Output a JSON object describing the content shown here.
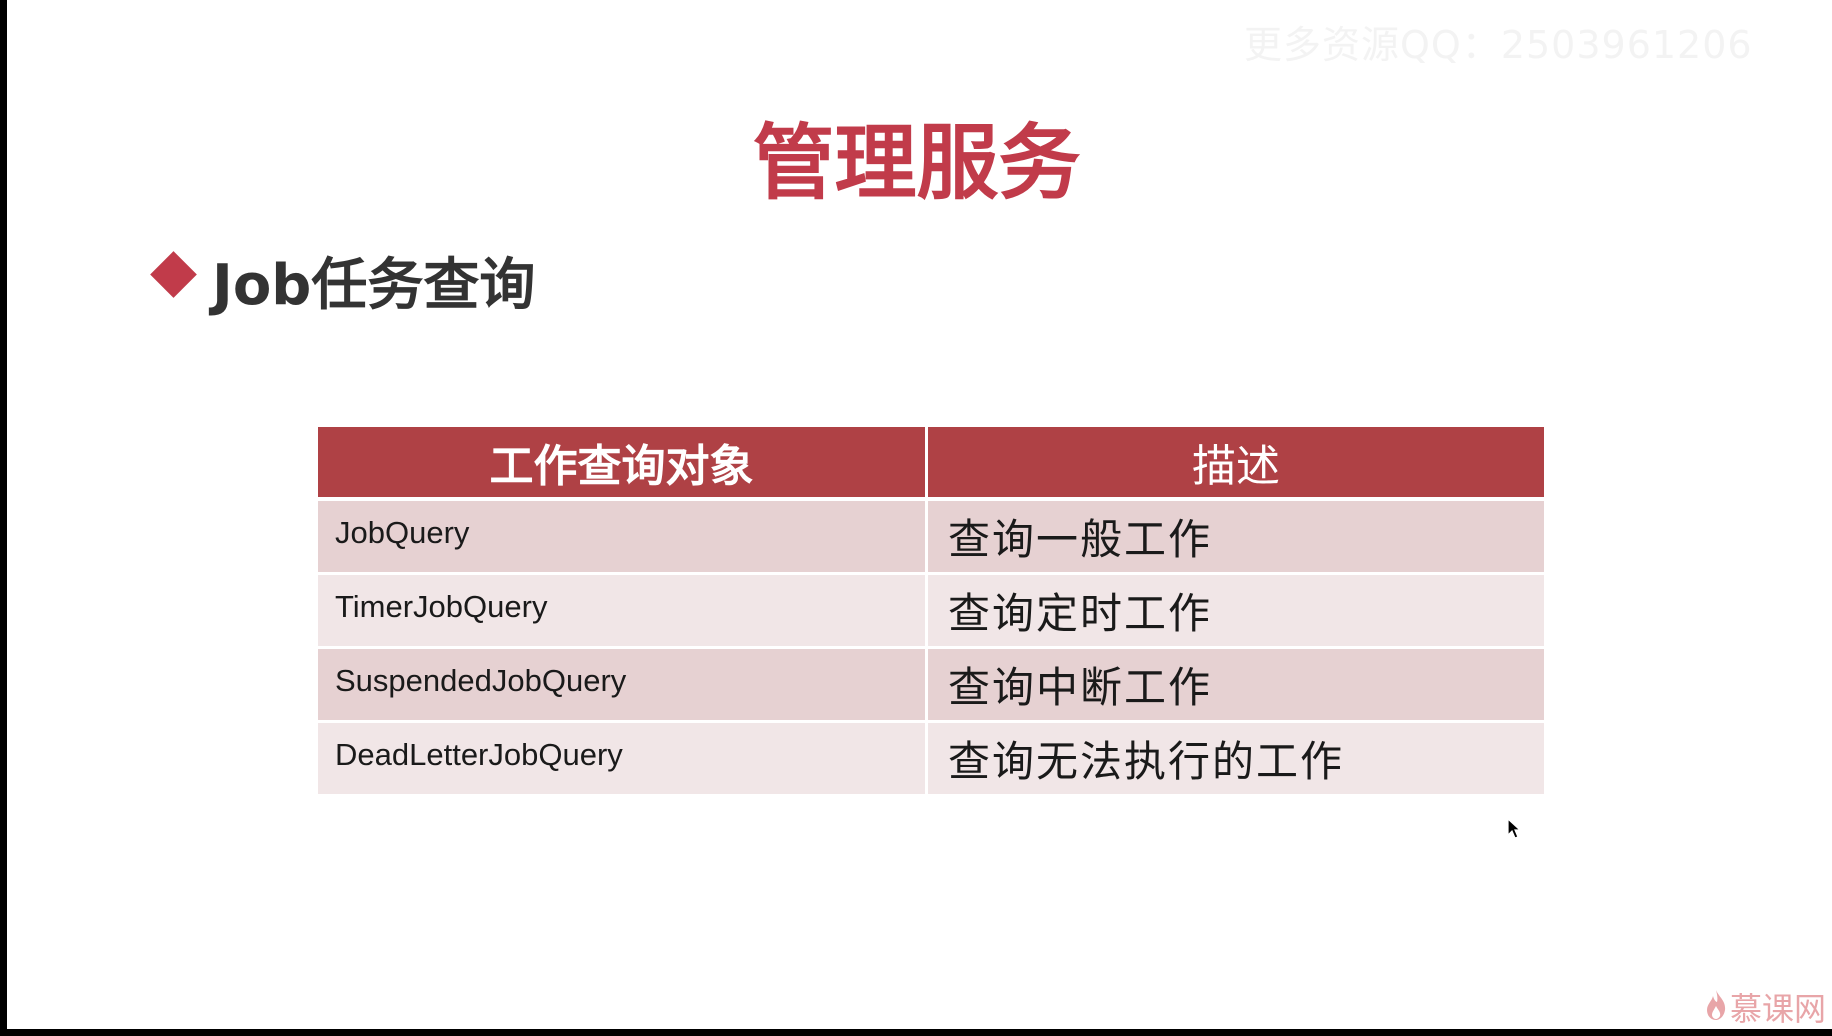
{
  "watermark": "更多资源QQ：2503961206",
  "title": "管理服务",
  "subtitle": "Job任务查询",
  "table": {
    "headers": [
      "工作查询对象",
      "描述"
    ],
    "rows": [
      {
        "name": "JobQuery",
        "desc": "查询一般工作"
      },
      {
        "name": "TimerJobQuery",
        "desc": "查询定时工作"
      },
      {
        "name": "SuspendedJobQuery",
        "desc": "查询中断工作"
      },
      {
        "name": "DeadLetterJobQuery",
        "desc": "查询无法执行的工作"
      }
    ]
  },
  "logo": {
    "text": "慕课网",
    "icon": "flame-icon"
  },
  "cursor": {
    "icon": "mouse-pointer-icon"
  },
  "colors": {
    "accent": "#c13b4a",
    "header_bg": "#af4145",
    "row_odd": "#e6d1d2",
    "row_even": "#f1e6e7"
  }
}
